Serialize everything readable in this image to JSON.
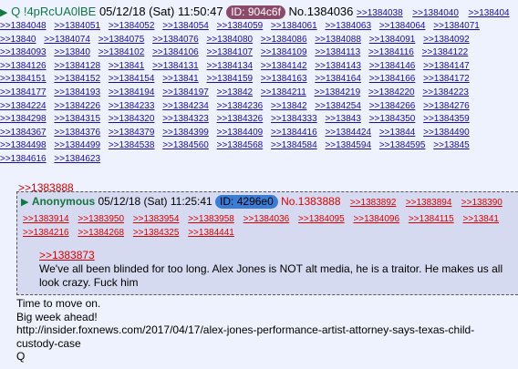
{
  "post": {
    "name": "Q",
    "trip": "!4pRcUA0lBE",
    "date": "05/12/18 (Sat) 11:50:47",
    "id_label": "ID: 904c6f",
    "no_label": "No.1384036",
    "header_links": [
      ">>1384038",
      ">>1384040",
      ">>138404"
    ],
    "backlinks": [
      ">>1384048",
      ">>1384051",
      ">>1384052",
      ">>1384054",
      ">>1384059",
      ">>1384061",
      ">>1384063",
      ">>1384064",
      ">>1384071",
      ">>13840",
      ">>1384074",
      ">>1384075",
      ">>1384076",
      ">>1384080",
      ">>1384086",
      ">>1384088",
      ">>1384091",
      ">>1384092",
      ">>1384093",
      ">>13840",
      ">>1384102",
      ">>1384106",
      ">>1384107",
      ">>1384109",
      ">>1384113",
      ">>1384116",
      ">>1384122",
      ">>1384126",
      ">>1384128",
      ">>13841",
      ">>1384131",
      ">>1384134",
      ">>1384142",
      ">>1384143",
      ">>1384146",
      ">>1384147",
      ">>1384151",
      ">>1384152",
      ">>1384154",
      ">>13841",
      ">>1384159",
      ">>1384163",
      ">>1384164",
      ">>1384166",
      ">>1384172",
      ">>1384177",
      ">>1384193",
      ">>1384194",
      ">>1384197",
      ">>13842",
      ">>1384211",
      ">>1384219",
      ">>1384220",
      ">>1384223",
      ">>1384224",
      ">>1384226",
      ">>1384233",
      ">>1384234",
      ">>1384236",
      ">>13842",
      ">>1384254",
      ">>1384266",
      ">>1384276",
      ">>1384298",
      ">>1384315",
      ">>1384320",
      ">>1384323",
      ">>1384326",
      ">>1384333",
      ">>13843",
      ">>1384350",
      ">>1384359",
      ">>1384367",
      ">>1384376",
      ">>1384379",
      ">>1384399",
      ">>1384409",
      ">>1384416",
      ">>1384424",
      ">>13844",
      ">>1384490",
      ">>1384498",
      ">>1384499",
      ">>1384538",
      ">>1384560",
      ">>1384568",
      ">>1384584",
      ">>1384594",
      ">>1384595",
      ">>13845",
      ">>1384616",
      ">>1384623"
    ],
    "body_lines": [
      "Time to move on.",
      "Big week ahead!",
      "http://insider.foxnews.com/2017/04/17/alex-jones-performance-artist-attorney-says-texas-child-custody-case",
      "Q"
    ]
  },
  "inline": {
    "quote_link": ">>1383888",
    "name": "Anonymous",
    "date": "05/12/18 (Sat) 11:25:41",
    "id_label": "ID: 4296e0",
    "no_label": "No.1383888",
    "header_links": [
      ">>1383892",
      ">>1383894",
      ">>138390"
    ],
    "backlinks": [
      ">>1383914",
      ">>1383950",
      ">>1383954",
      ">>1383958",
      ">>1384036",
      ">>1384095",
      ">>1384096",
      ">>1384115",
      ">>13841",
      ">>1384216",
      ">>1384268",
      ">>1384325",
      ">>1384441"
    ],
    "quoted_ref": ">>1383873",
    "text": "We've all been blinded for too long. Alex Jones is NOT alt media, he is a traitor. He makes us all look crazy. Fuck him"
  },
  "colors": {
    "background": "#eef2ff",
    "name_green": "#117743",
    "id_q": "#8b4a6a",
    "id_anon": "#3a7dd6",
    "link_blue": "#1a0dab",
    "link_red": "#dd0000",
    "inline_bg": "#d6daf0"
  },
  "icons": {
    "collapse": "chevron-right-icon"
  }
}
